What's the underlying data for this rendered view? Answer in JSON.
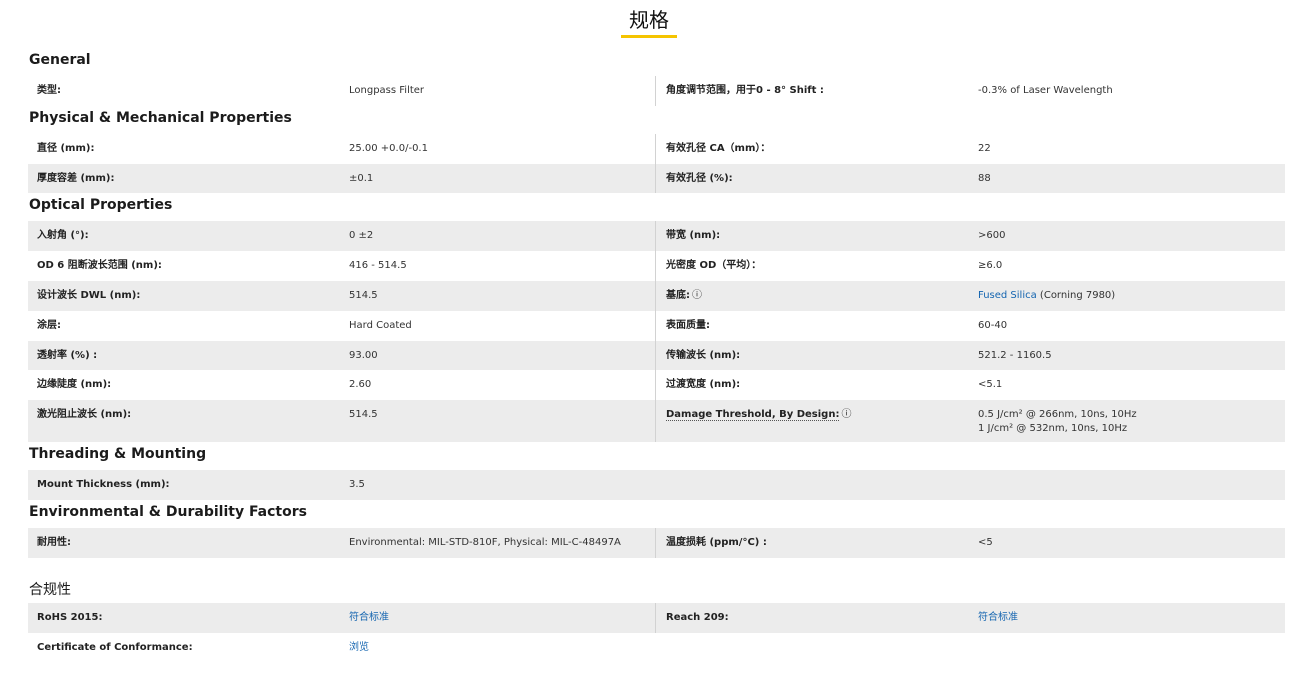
{
  "page_title": "规格",
  "sections": {
    "general": "General",
    "physical": "Physical & Mechanical Properties",
    "optical": "Optical Properties",
    "threading": "Threading & Mounting",
    "environmental": "Environmental & Durability Factors",
    "compliance": "合规性"
  },
  "rows": {
    "type": {
      "l1": "类型:",
      "v1": "Longpass Filter",
      "l2": "角度调节范围，用于0 - 8° Shift :",
      "v2": "-0.3% of Laser Wavelength"
    },
    "diameter": {
      "l1": "直径 (mm):",
      "v1": "25.00 +0.0/-0.1",
      "l2": "有效孔径 CA（mm）：",
      "v2": "22"
    },
    "thickness": {
      "l1": "厚度容差 (mm):",
      "v1": "±0.1",
      "l2": "有效孔径 (%):",
      "v2": "88"
    },
    "aoi": {
      "l1": "入射角 (°):",
      "v1": "0 ±2",
      "l2": "带宽 (nm):",
      "v2": ">600"
    },
    "od6": {
      "l1": "OD 6 阻断波长范围 (nm):",
      "v1": "416 - 514.5",
      "l2": "光密度 OD（平均）：",
      "v2": "≥6.0"
    },
    "dwl": {
      "l1": "设计波长 DWL (nm):",
      "v1": "514.5",
      "l2": "基底:",
      "v2_link": "Fused Silica",
      "v2_rest": " (Corning 7980)"
    },
    "coating": {
      "l1": "涂层:",
      "v1": "Hard Coated",
      "l2": "表面质量:",
      "v2": "60-40"
    },
    "trans": {
      "l1": "透射率 (%) :",
      "v1": "93.00",
      "l2": "传输波长 (nm):",
      "v2": "521.2 - 1160.5"
    },
    "edge": {
      "l1": "边缘陡度 (nm):",
      "v1": "2.60",
      "l2": "过渡宽度 (nm):",
      "v2": "<5.1"
    },
    "laser": {
      "l1": "激光阻止波长 (nm):",
      "v1": "514.5",
      "l2": "Damage Threshold, By Design:",
      "v2a": "0.5 J/cm² @ 266nm, 10ns, 10Hz",
      "v2b": "1 J/cm² @ 532nm, 10ns, 10Hz"
    },
    "mount": {
      "l1": "Mount Thickness (mm):",
      "v1": "3.5"
    },
    "durab": {
      "l1": "耐用性:",
      "v1": "Environmental: MIL-STD-810F, Physical: MIL-C-48497A",
      "l2": "温度损耗 (ppm/°C) :",
      "v2": "<5"
    },
    "rohs": {
      "l1": "RoHS 2015:",
      "v1": "符合标准",
      "l2": "Reach 209:",
      "v2": "符合标准"
    },
    "coc": {
      "l1": "Certificate of Conformance:",
      "v1": "浏览"
    }
  },
  "info_icon": "ⓘ",
  "colors": {
    "accent": "#f5c400",
    "row_shade": "#ececec",
    "link": "#1565b0"
  }
}
